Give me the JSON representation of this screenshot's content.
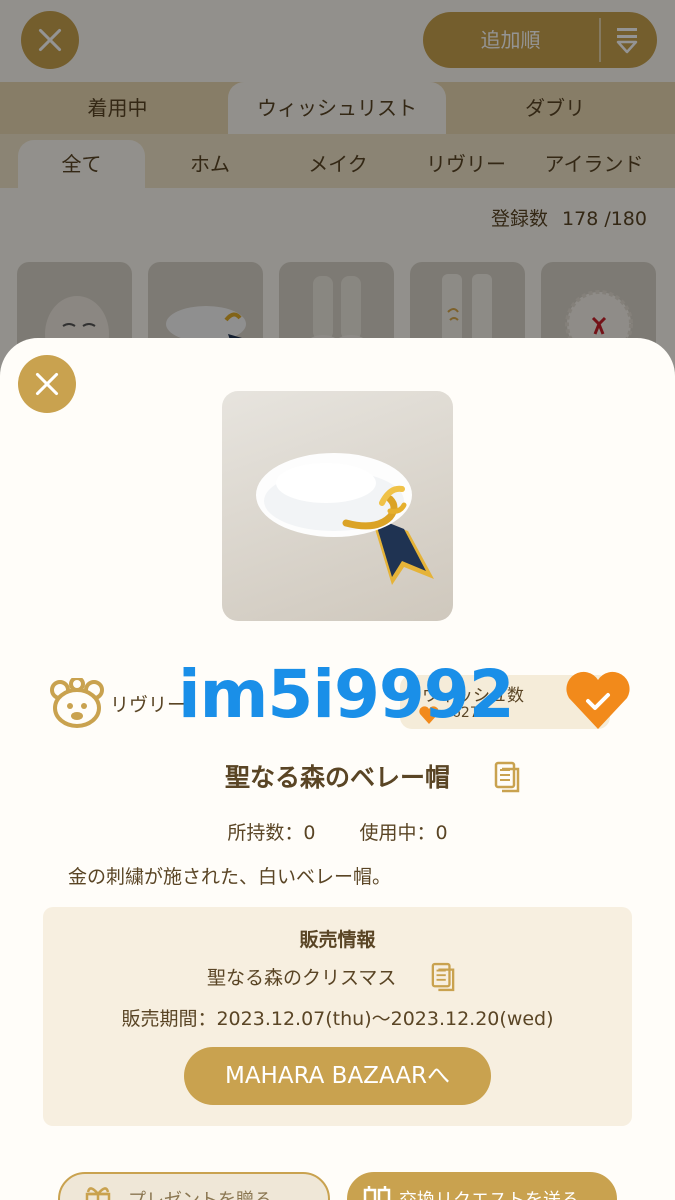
{
  "header": {
    "sort_label": "追加順"
  },
  "tabs_primary": [
    "着用中",
    "ウィッシュリスト",
    "ダブリ"
  ],
  "tabs_secondary": [
    "全て",
    "ホム",
    "メイク",
    "リヴリー",
    "アイランド"
  ],
  "registration": {
    "label": "登録数",
    "value": "178 /180"
  },
  "modal": {
    "brand_label": "リヴリー",
    "watermark": "im5i9992",
    "wish": {
      "label": "ウィッシュ数",
      "value": "6273"
    },
    "item_name": "聖なる森のベレー帽",
    "owned": "所持数：0",
    "in_use": "使用中：0",
    "description": "金の刺繍が施された、白いベレー帽。",
    "sales": {
      "title": "販売情報",
      "event": "聖なる森のクリスマス",
      "period": "販売期間：2023.12.07(thu)〜2023.12.20(wed)",
      "button": "MAHARA BAZAARへ"
    },
    "bottom_buttons": [
      "プレゼントを贈る",
      "交換リクエストを送る"
    ]
  },
  "colors": {
    "accent_gold": "#c9a24f",
    "heart_orange": "#f28a1b",
    "watermark_blue": "#1a8fe8",
    "text_brown": "#5a4525"
  }
}
